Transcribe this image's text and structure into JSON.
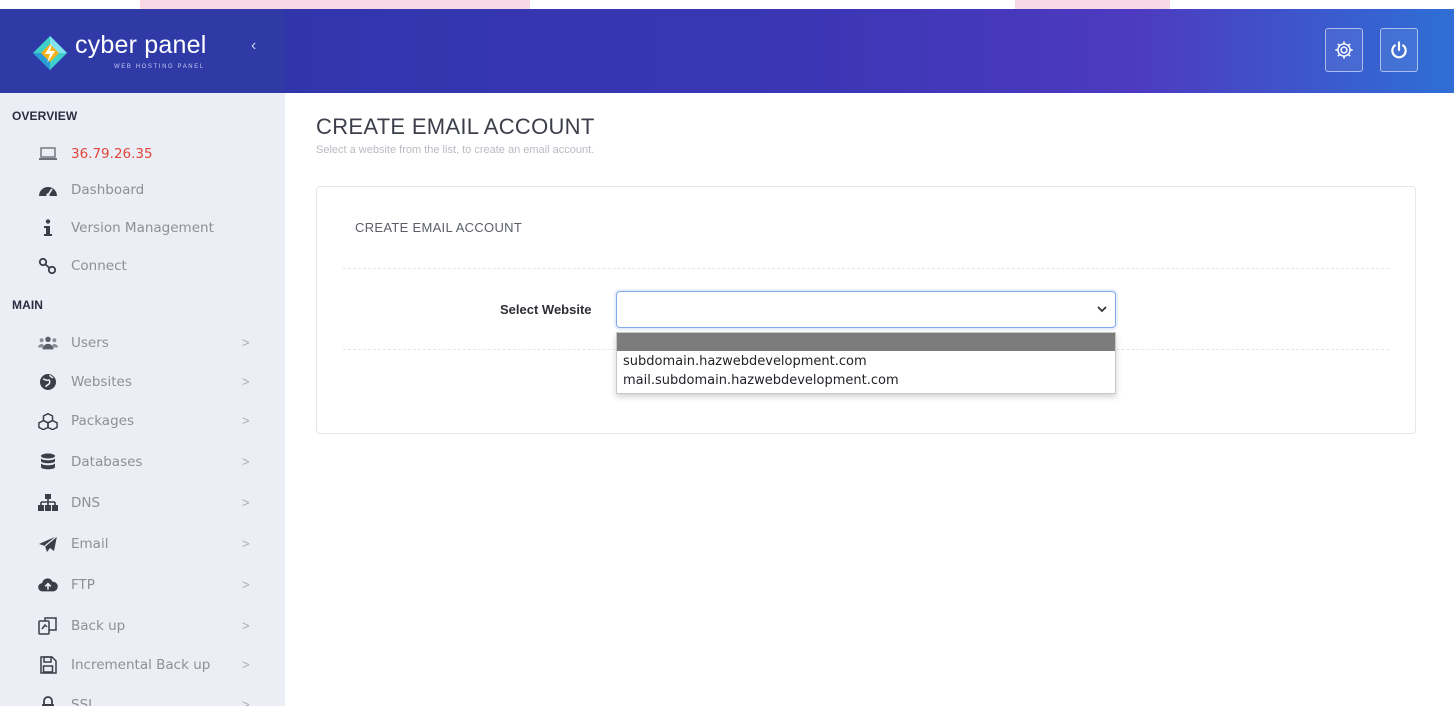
{
  "brand": {
    "name": "cyber panel",
    "subtitle": "WEB HOSTING PANEL"
  },
  "header": {
    "icons": [
      "gear-icon",
      "power-icon"
    ]
  },
  "sidebar": {
    "overview_title": "OVERVIEW",
    "overview_items": [
      {
        "label": "36.79.26.35",
        "icon": "laptop-icon"
      },
      {
        "label": "Dashboard",
        "icon": "dashboard-icon"
      },
      {
        "label": "Version Management",
        "icon": "info-icon"
      },
      {
        "label": "Connect",
        "icon": "link-icon"
      }
    ],
    "main_title": "MAIN",
    "main_items": [
      {
        "label": "Users",
        "icon": "users-icon"
      },
      {
        "label": "Websites",
        "icon": "globe-icon"
      },
      {
        "label": "Packages",
        "icon": "packages-icon"
      },
      {
        "label": "Databases",
        "icon": "database-icon"
      },
      {
        "label": "DNS",
        "icon": "sitemap-icon"
      },
      {
        "label": "Email",
        "icon": "paper-plane-icon"
      },
      {
        "label": "FTP",
        "icon": "cloud-upload-icon"
      },
      {
        "label": "Back up",
        "icon": "copy-icon"
      },
      {
        "label": "Incremental Back up",
        "icon": "save-icon"
      },
      {
        "label": "SSL",
        "icon": "lock-icon"
      }
    ],
    "chevron": ">"
  },
  "main": {
    "page_title": "CREATE EMAIL ACCOUNT",
    "page_subtitle": "Select a website from the list, to create an email account.",
    "card": {
      "title": "CREATE EMAIL ACCOUNT",
      "select_label": "Select Website",
      "select_value": "",
      "options": [
        "",
        "subdomain.hazwebdevelopment.com",
        "mail.subdomain.hazwebdevelopment.com"
      ]
    }
  },
  "colors": {
    "header_bg": "#3a36b4",
    "sidebar_bg": "#ebeef4",
    "ip_text": "#e2453c",
    "select_focus_border": "#86a9e8"
  }
}
